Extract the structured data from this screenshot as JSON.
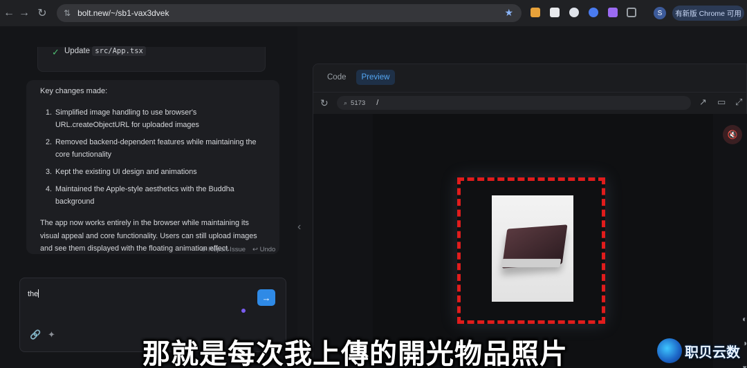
{
  "browser": {
    "url": "bolt.new/~/sb1-vax3dvek",
    "profile_initial": "S",
    "update_label": "有新版 Chrome 可用",
    "nav_back": "←",
    "nav_forward": "→",
    "nav_reload": "↻",
    "site_icon": "⇅",
    "star_icon": "★"
  },
  "chat": {
    "update_item": {
      "check": "✓",
      "label": "Update",
      "file": "src/App.tsx"
    },
    "heading": "Key changes made:",
    "changes": [
      {
        "num": "1.",
        "text": "Simplified image handling to use browser's URL.createObjectURL for uploaded images"
      },
      {
        "num": "2.",
        "text": "Removed backend-dependent features while maintaining the core functionality"
      },
      {
        "num": "3.",
        "text": "Kept the existing UI design and animations"
      },
      {
        "num": "4.",
        "text": "Maintained the Apple-style aesthetics with the Buddha background"
      }
    ],
    "summary": "The app now works entirely in the browser while maintaining its visual appeal and core functionality. Users can still upload images and see them displayed with the floating animation effect.",
    "report_issue": "⚙ Report Issue",
    "undo": "↩ Undo",
    "input_value": "the",
    "send_icon": "→",
    "link_icon": "🔗",
    "spark_icon": "✦",
    "collapse_icon": "‹"
  },
  "workbench": {
    "tabs": [
      {
        "label": "Code"
      },
      {
        "label": "Preview"
      }
    ],
    "reload_icon": "↻",
    "port_icon": "⌕",
    "port": "5173",
    "path": "/",
    "open_icon": "↗",
    "device_icon": "▭",
    "fullscreen_icon": "⤢",
    "mute_icon": "🔇"
  },
  "overlay": {
    "subtitle": "那就是每次我上傳的開光物品照片",
    "watermark": "职贝云数"
  },
  "colors": {
    "accent": "#2f8ae6",
    "preview_tab": "#55a8f5",
    "dashed_border": "#e01c1c",
    "success": "#4fbf73"
  }
}
